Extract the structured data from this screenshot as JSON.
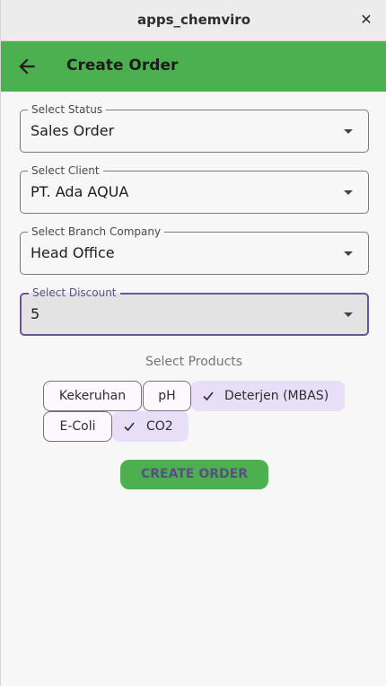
{
  "window": {
    "title": "apps_chemviro",
    "close_glyph": "✕"
  },
  "appbar": {
    "title": "Create Order",
    "back_icon": "arrow-left-icon"
  },
  "form": {
    "status": {
      "label": "Select Status",
      "value": "Sales Order"
    },
    "client": {
      "label": "Select Client",
      "value": "PT. Ada AQUA"
    },
    "branch": {
      "label": "Select Branch Company",
      "value": "Head Office"
    },
    "discount": {
      "label": "Select Discount",
      "value": "5"
    }
  },
  "products": {
    "title": "Select Products",
    "items": [
      {
        "label": "Kekeruhan",
        "selected": false
      },
      {
        "label": "pH",
        "selected": false
      },
      {
        "label": "Deterjen (MBAS)",
        "selected": true
      },
      {
        "label": "E-Coli",
        "selected": false
      },
      {
        "label": "CO2",
        "selected": true
      }
    ]
  },
  "actions": {
    "create_label": "CREATE ORDER"
  },
  "colors": {
    "primary": "#4caf50",
    "chip_selected": "#e8def8",
    "focus": "#6a5593"
  }
}
